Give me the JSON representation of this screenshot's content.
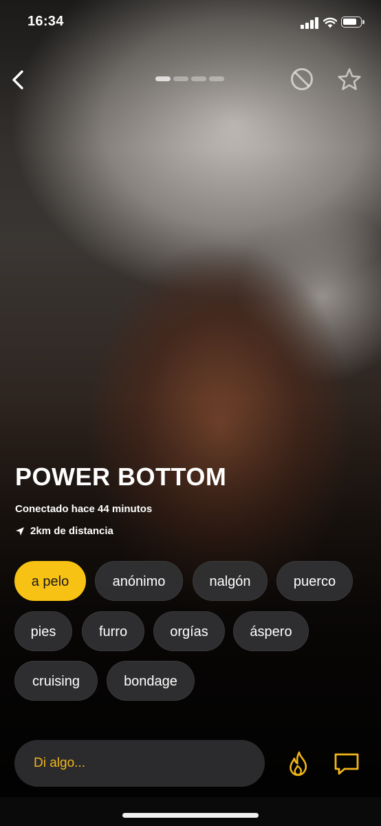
{
  "status_bar": {
    "time": "16:34"
  },
  "profile": {
    "name": "POWER BOTTOM",
    "last_seen": "Conectado hace 44 minutos",
    "distance": "2km de distancia",
    "photo_count": 4,
    "current_photo": 1
  },
  "tags": [
    {
      "label": "a pelo",
      "selected": true
    },
    {
      "label": "anónimo",
      "selected": false
    },
    {
      "label": "nalgón",
      "selected": false
    },
    {
      "label": "puerco",
      "selected": false
    },
    {
      "label": "pies",
      "selected": false
    },
    {
      "label": "furro",
      "selected": false
    },
    {
      "label": "orgías",
      "selected": false
    },
    {
      "label": "áspero",
      "selected": false
    },
    {
      "label": "cruising",
      "selected": false
    },
    {
      "label": "bondage",
      "selected": false
    }
  ],
  "message": {
    "placeholder": "Di algo..."
  },
  "icons": {
    "back": "chevron-left-icon",
    "block": "block-icon",
    "favorite": "star-icon",
    "tap": "flame-icon",
    "chat": "chat-bubble-icon",
    "location": "location-arrow-icon"
  },
  "colors": {
    "accent": "#f7c213",
    "chip_bg": "#323234",
    "input_bg": "#2b2b2d"
  }
}
